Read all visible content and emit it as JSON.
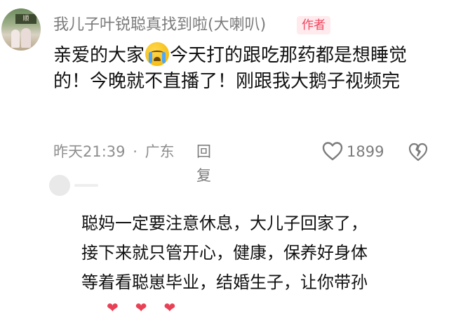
{
  "comment": {
    "username": "我儿子叶锐聪真找到啦(大喇叭)",
    "author_badge": "作者",
    "text_part1": "亲爱的大家",
    "emoji": "crying-face-icon",
    "text_part2": "今天打的跟吃那药都是想睡觉的！今晚就不直播了！刚跟我大鹅子视频完",
    "time": "昨天21:39",
    "separator": "·",
    "location": "广东",
    "reply_label": "回复",
    "like_count": "1899"
  },
  "reply": {
    "text": "聪妈一定要注意休息，大儿子回家了，\n接下来就只管开心，健康，保养好身体\n等着看聪崽毕业，结婚生子，让你带孙"
  },
  "colors": {
    "badge_text": "#f0465e",
    "badge_bg": "#ffeaed",
    "meta_gray": "#8e8e8e"
  }
}
